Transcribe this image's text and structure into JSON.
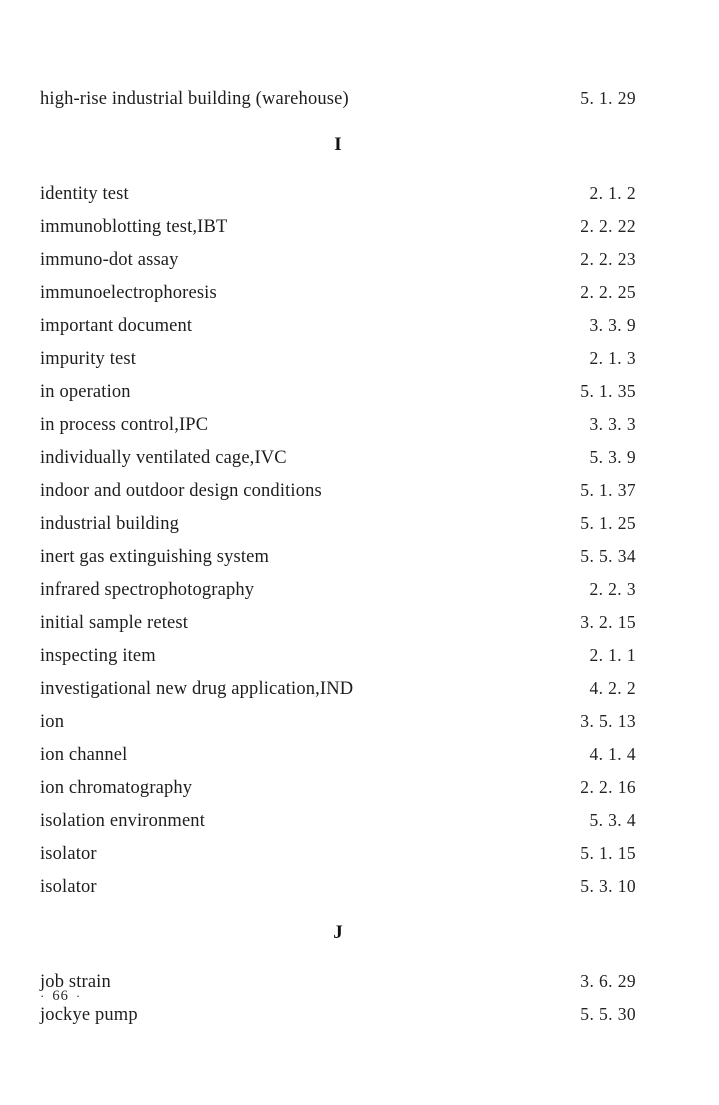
{
  "page": {
    "folio_left_mark": "·",
    "folio_number": "66",
    "folio_right_mark": "·"
  },
  "sections": [
    {
      "letter": null,
      "entries": [
        {
          "term": "high-rise industrial building (warehouse)",
          "page": "5. 1. 29"
        }
      ]
    },
    {
      "letter": "I",
      "entries": [
        {
          "term": "identity test",
          "page": "2. 1. 2"
        },
        {
          "term": "immunoblotting test,IBT",
          "page": "2. 2. 22"
        },
        {
          "term": "immuno-dot assay",
          "page": "2. 2. 23"
        },
        {
          "term": "immunoelectrophoresis",
          "page": "2. 2. 25"
        },
        {
          "term": "important document",
          "page": "3. 3. 9"
        },
        {
          "term": "impurity test",
          "page": "2. 1. 3"
        },
        {
          "term": "in operation",
          "page": "5. 1. 35"
        },
        {
          "term": "in process control,IPC",
          "page": "3. 3. 3"
        },
        {
          "term": "individually ventilated cage,IVC",
          "page": "5. 3. 9"
        },
        {
          "term": "indoor and outdoor design conditions",
          "page": "5. 1. 37"
        },
        {
          "term": "industrial building",
          "page": "5. 1. 25"
        },
        {
          "term": "inert gas extinguishing system",
          "page": "5. 5. 34"
        },
        {
          "term": "infrared spectrophotography",
          "page": "2. 2. 3"
        },
        {
          "term": "initial sample retest",
          "page": "3. 2. 15"
        },
        {
          "term": "inspecting item",
          "page": "2. 1. 1"
        },
        {
          "term": "investigational new drug application,IND",
          "page": "4. 2. 2"
        },
        {
          "term": "ion",
          "page": "3. 5. 13"
        },
        {
          "term": "ion channel",
          "page": "4. 1. 4"
        },
        {
          "term": "ion chromatography",
          "page": "2. 2. 16"
        },
        {
          "term": "isolation environment",
          "page": "5. 3. 4"
        },
        {
          "term": "isolator",
          "page": "5. 1. 15"
        },
        {
          "term": "isolator",
          "page": "5. 3. 10"
        }
      ]
    },
    {
      "letter": "J",
      "entries": [
        {
          "term": "job strain",
          "page": "3. 6. 29"
        },
        {
          "term": "jockye pump",
          "page": "5. 5. 30"
        }
      ]
    }
  ]
}
